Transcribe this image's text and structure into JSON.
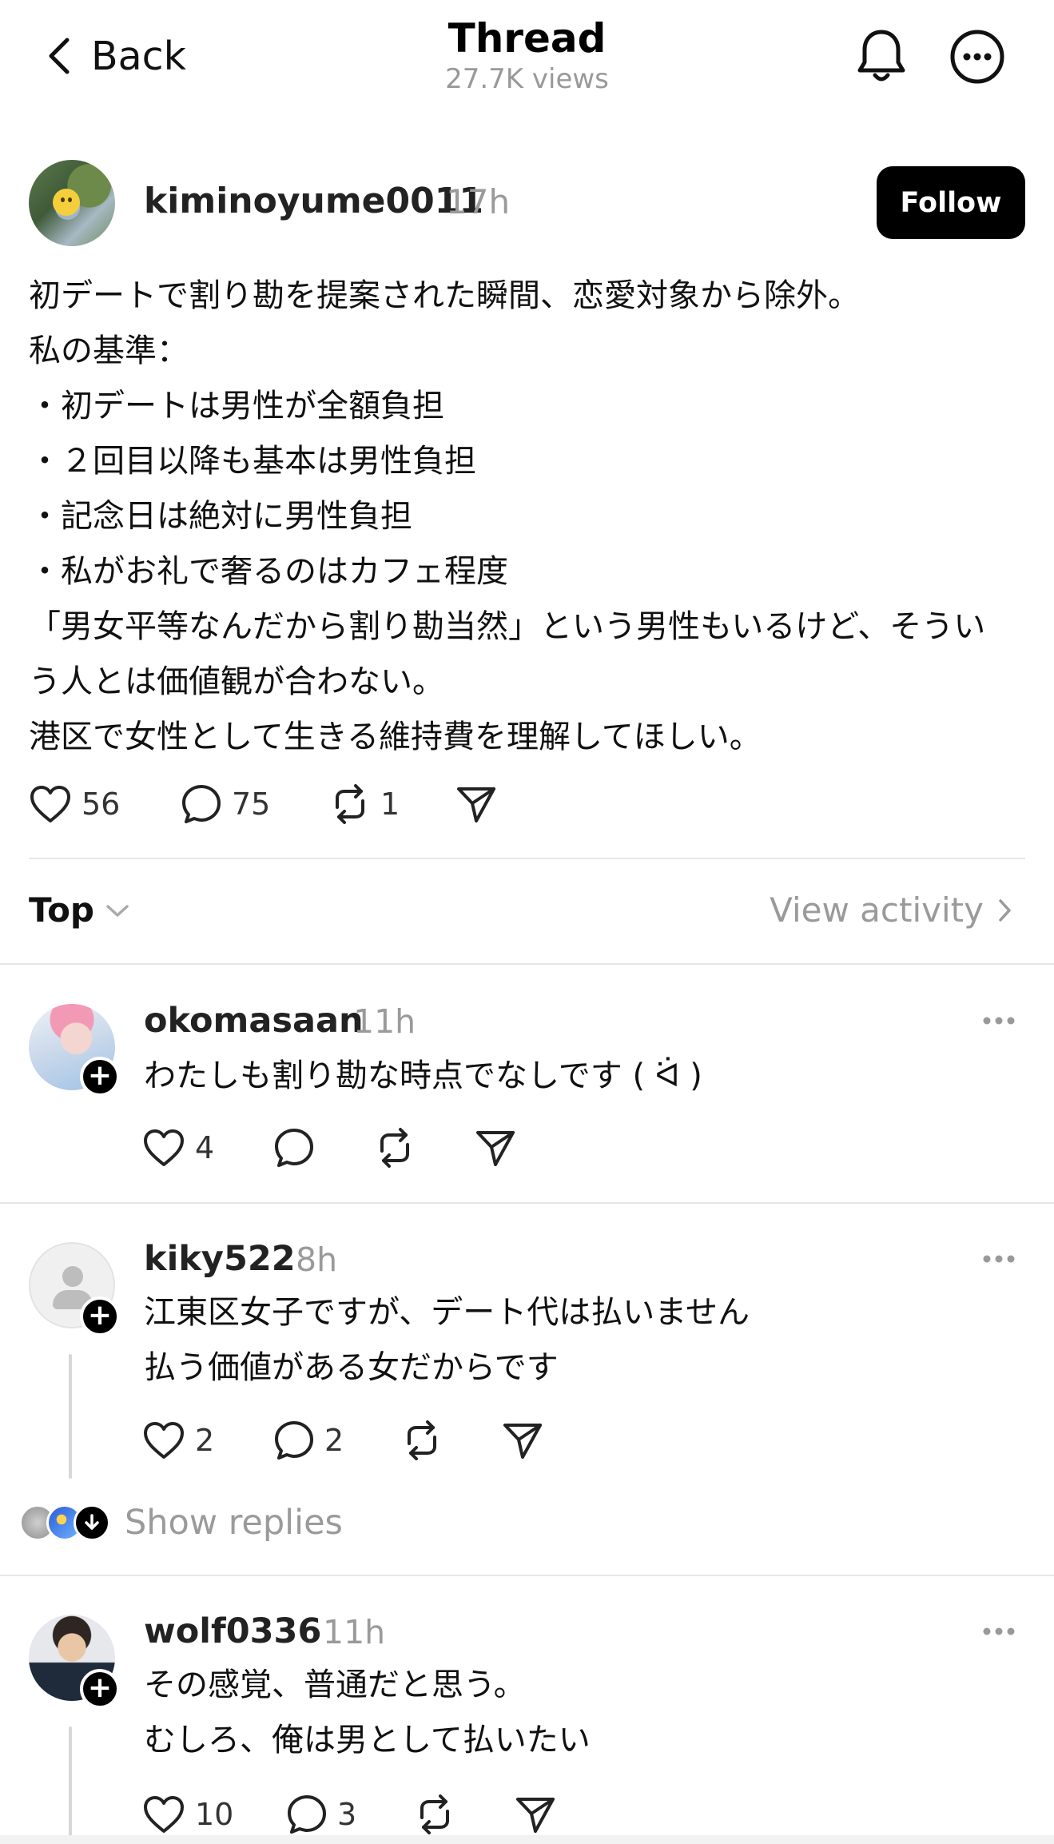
{
  "header": {
    "back_label": "Back",
    "title": "Thread",
    "views": "27.7K views",
    "icons": [
      "chevron-left-icon",
      "bell-icon",
      "more-circle-icon"
    ]
  },
  "post": {
    "username": "kiminoyume0011",
    "time": "17h",
    "follow_label": "Follow",
    "lines": [
      "初デートで割り勘を提案された瞬間、恋愛対象から除外。",
      "私の基準：",
      "・初デートは男性が全額負担",
      "・２回目以降も基本は男性負担",
      "・記念日は絶対に男性負担",
      "・私がお礼で奢るのはカフェ程度",
      "「男女平等なんだから割り勘当然」という男性もいるけど、そうい",
      "う人とは価値観が合わない。",
      "港区で女性として生きる維持費を理解してほしい。"
    ],
    "likes": "56",
    "comments": "75",
    "reposts": "1"
  },
  "sort": {
    "label": "Top",
    "view_activity": "View activity"
  },
  "replies": [
    {
      "username": "okomasaan",
      "time": "11h",
      "lines": [
        "わたしも割り勘な時点でなしです ( ᐛ )"
      ],
      "likes": "4",
      "comments": "",
      "reposts": ""
    },
    {
      "username": "kiky522",
      "time": "8h",
      "lines": [
        "江東区女子ですが、デート代は払いません",
        "払う価値がある女だからです"
      ],
      "likes": "2",
      "comments": "2",
      "reposts": ""
    },
    {
      "username": "wolf0336",
      "time": "11h",
      "lines": [
        "その感覚、普通だと思う。",
        "むしろ、俺は男として払いたい"
      ],
      "likes": "10",
      "comments": "3",
      "reposts": ""
    }
  ],
  "show_replies_label": "Show replies",
  "colors": {
    "text": "#111111",
    "muted": "#9a9a9a",
    "divider": "#e6e6e6",
    "button_bg": "#000000",
    "button_text": "#ffffff"
  }
}
